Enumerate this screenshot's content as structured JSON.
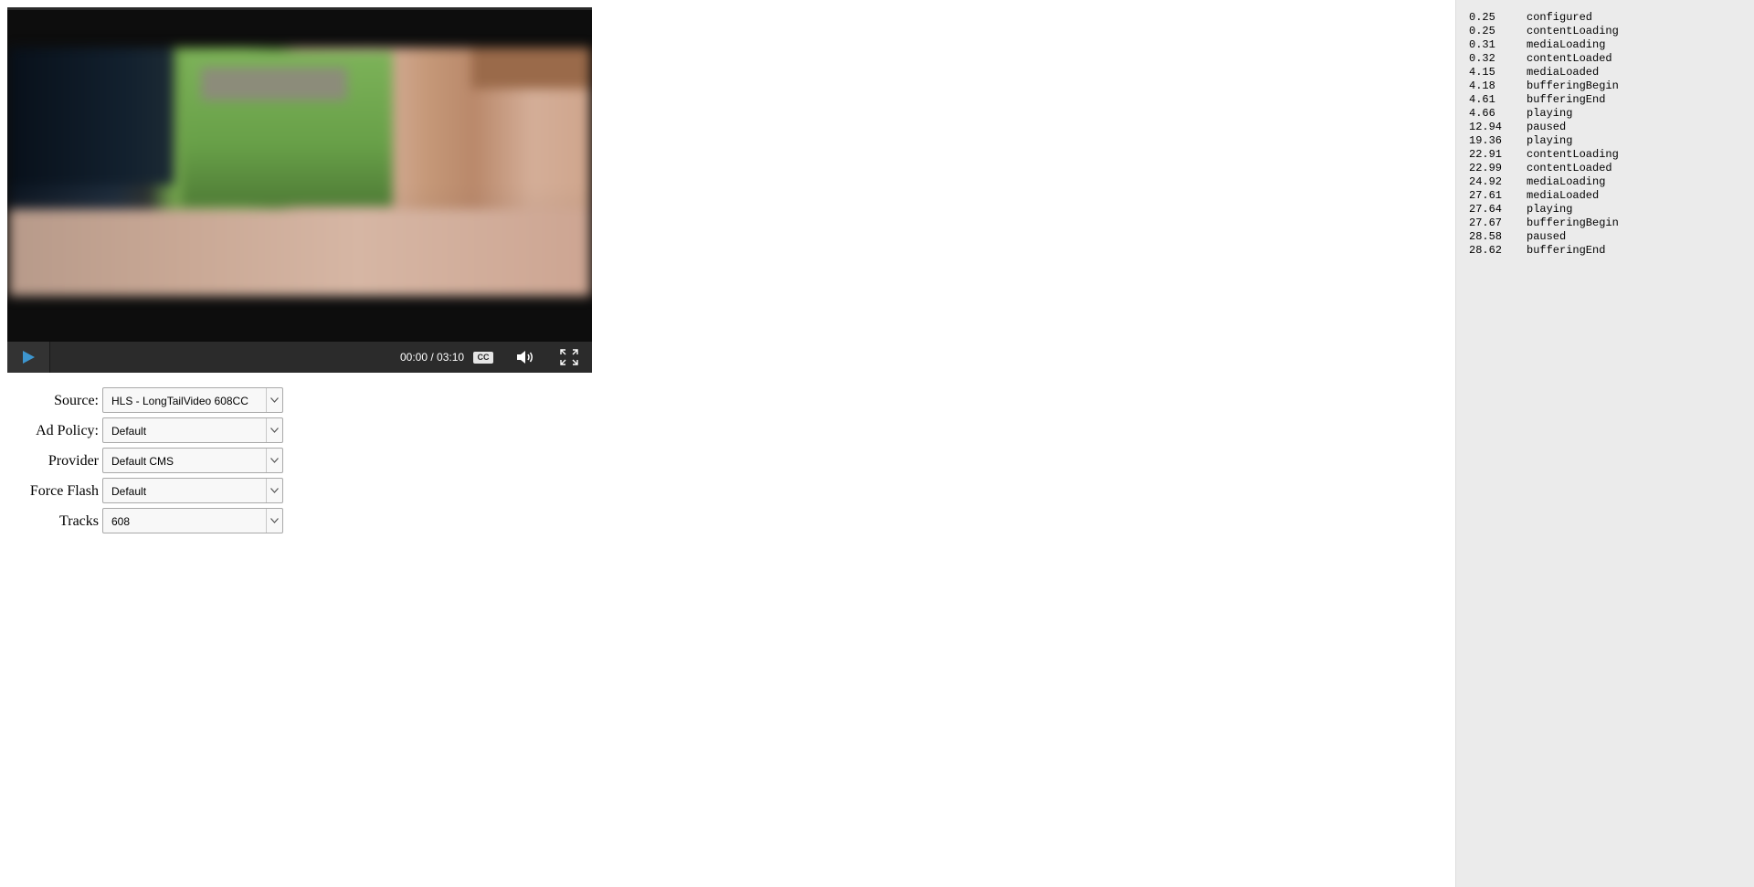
{
  "player": {
    "time_display": "00:00 / 03:10",
    "cc_label": "CC",
    "accent_color": "#3d95ce"
  },
  "settings": [
    {
      "label": "Source:",
      "value": "HLS - LongTailVideo 608CC"
    },
    {
      "label": "Ad Policy:",
      "value": "Default"
    },
    {
      "label": "Provider",
      "value": "Default CMS"
    },
    {
      "label": "Force Flash",
      "value": "Default"
    },
    {
      "label": "Tracks",
      "value": "608"
    }
  ],
  "event_log": [
    {
      "time": "0.25",
      "event": "configured"
    },
    {
      "time": "0.25",
      "event": "contentLoading"
    },
    {
      "time": "0.31",
      "event": "mediaLoading"
    },
    {
      "time": "0.32",
      "event": "contentLoaded"
    },
    {
      "time": "4.15",
      "event": "mediaLoaded"
    },
    {
      "time": "4.18",
      "event": "bufferingBegin"
    },
    {
      "time": "4.61",
      "event": "bufferingEnd"
    },
    {
      "time": "4.66",
      "event": "playing"
    },
    {
      "time": "12.94",
      "event": "paused"
    },
    {
      "time": "19.36",
      "event": "playing"
    },
    {
      "time": "22.91",
      "event": "contentLoading"
    },
    {
      "time": "22.99",
      "event": "contentLoaded"
    },
    {
      "time": "24.92",
      "event": "mediaLoading"
    },
    {
      "time": "27.61",
      "event": "mediaLoaded"
    },
    {
      "time": "27.64",
      "event": "playing"
    },
    {
      "time": "27.67",
      "event": "bufferingBegin"
    },
    {
      "time": "28.58",
      "event": "paused"
    },
    {
      "time": "28.62",
      "event": "bufferingEnd"
    }
  ]
}
